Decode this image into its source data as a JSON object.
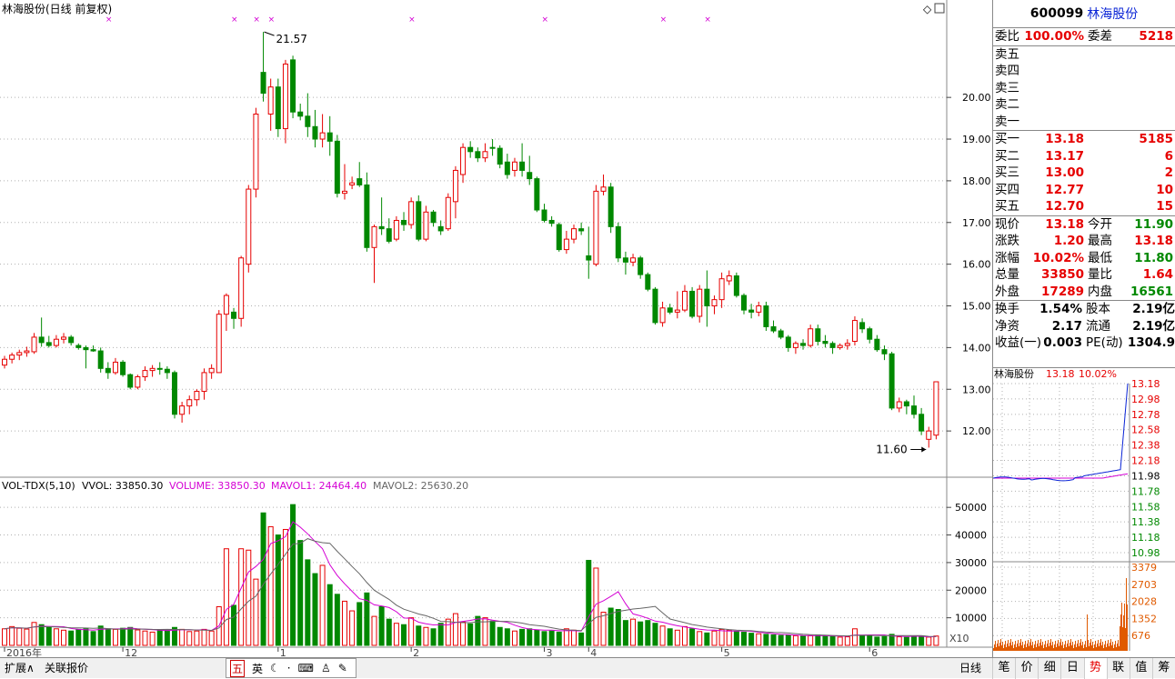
{
  "chart_title": "林海股份(日线 前复权)",
  "max_label": "21.57",
  "min_label": "11.60",
  "vol_header": {
    "name": "VOL-TDX(5,10)",
    "vvol": "VVOL: 33850.30",
    "volume": "VOLUME: 33850.30",
    "mavol1": "MAVOL1: 24464.40",
    "mavol2": "MAVOL2: 25630.20"
  },
  "x_tick_labels": [
    {
      "text": "2016年",
      "index": 0
    },
    {
      "text": "12",
      "index": 16
    },
    {
      "text": "1",
      "index": 37
    },
    {
      "text": "2",
      "index": 55
    },
    {
      "text": "3",
      "index": 73
    },
    {
      "text": "4",
      "index": 79
    },
    {
      "text": "5",
      "index": 97
    },
    {
      "text": "6",
      "index": 117
    }
  ],
  "price_axis_ticks": [
    "12.00",
    "13.00",
    "14.00",
    "15.00",
    "16.00",
    "17.00",
    "18.00",
    "19.00",
    "20.00"
  ],
  "vol_axis_ticks": [
    "10000",
    "20000",
    "30000",
    "40000",
    "50000"
  ],
  "vol_multiplier": "X10",
  "colors": {
    "up": "#e60000",
    "down": "#008800",
    "ma1": "#d400d4",
    "ma2": "#555555",
    "info_marker": "#d400d4"
  },
  "chart_data": {
    "type": "candlestick",
    "title": "林海股份(日线 前复权)",
    "ylim": [
      11.0,
      21.9
    ],
    "vol_ylim": [
      0,
      55000
    ],
    "info_marker_indices": [
      14,
      31,
      34,
      36,
      55,
      73,
      89,
      95
    ],
    "candles": [
      {
        "o": 13.58,
        "h": 13.8,
        "l": 13.5,
        "c": 13.72,
        "v": 6000
      },
      {
        "o": 13.72,
        "h": 13.88,
        "l": 13.62,
        "c": 13.82,
        "v": 6800
      },
      {
        "o": 13.82,
        "h": 13.95,
        "l": 13.7,
        "c": 13.88,
        "v": 6200
      },
      {
        "o": 13.88,
        "h": 14.02,
        "l": 13.78,
        "c": 13.92,
        "v": 5900
      },
      {
        "o": 13.9,
        "h": 14.35,
        "l": 13.85,
        "c": 14.25,
        "v": 8300
      },
      {
        "o": 14.25,
        "h": 14.72,
        "l": 14.02,
        "c": 14.12,
        "v": 7500
      },
      {
        "o": 14.12,
        "h": 14.28,
        "l": 14.0,
        "c": 14.05,
        "v": 6500
      },
      {
        "o": 14.05,
        "h": 14.3,
        "l": 14.0,
        "c": 14.2,
        "v": 6000
      },
      {
        "o": 14.2,
        "h": 14.35,
        "l": 14.1,
        "c": 14.25,
        "v": 5500
      },
      {
        "o": 14.25,
        "h": 14.3,
        "l": 14.05,
        "c": 14.12,
        "v": 5200
      },
      {
        "o": 14.05,
        "h": 14.1,
        "l": 13.95,
        "c": 14.0,
        "v": 5800
      },
      {
        "o": 14.0,
        "h": 14.05,
        "l": 13.5,
        "c": 13.95,
        "v": 6000
      },
      {
        "o": 13.95,
        "h": 14.05,
        "l": 13.9,
        "c": 13.92,
        "v": 5000
      },
      {
        "o": 13.92,
        "h": 14.0,
        "l": 13.4,
        "c": 13.5,
        "v": 7000
      },
      {
        "o": 13.5,
        "h": 13.65,
        "l": 13.25,
        "c": 13.4,
        "v": 6000
      },
      {
        "o": 13.4,
        "h": 13.75,
        "l": 13.35,
        "c": 13.65,
        "v": 5800
      },
      {
        "o": 13.65,
        "h": 13.7,
        "l": 13.3,
        "c": 13.35,
        "v": 6200
      },
      {
        "o": 13.35,
        "h": 13.38,
        "l": 13.0,
        "c": 13.05,
        "v": 6500
      },
      {
        "o": 13.05,
        "h": 13.35,
        "l": 13.0,
        "c": 13.3,
        "v": 5600
      },
      {
        "o": 13.3,
        "h": 13.55,
        "l": 13.2,
        "c": 13.45,
        "v": 5200
      },
      {
        "o": 13.45,
        "h": 13.58,
        "l": 13.3,
        "c": 13.5,
        "v": 4800
      },
      {
        "o": 13.5,
        "h": 13.65,
        "l": 13.35,
        "c": 13.48,
        "v": 5600
      },
      {
        "o": 13.48,
        "h": 13.55,
        "l": 13.25,
        "c": 13.4,
        "v": 5400
      },
      {
        "o": 13.4,
        "h": 13.45,
        "l": 12.3,
        "c": 12.4,
        "v": 6500
      },
      {
        "o": 12.4,
        "h": 12.7,
        "l": 12.2,
        "c": 12.6,
        "v": 5800
      },
      {
        "o": 12.6,
        "h": 12.85,
        "l": 12.4,
        "c": 12.75,
        "v": 5000
      },
      {
        "o": 12.75,
        "h": 13.0,
        "l": 12.6,
        "c": 12.95,
        "v": 5200
      },
      {
        "o": 12.95,
        "h": 13.5,
        "l": 12.75,
        "c": 13.4,
        "v": 5800
      },
      {
        "o": 13.4,
        "h": 13.6,
        "l": 13.25,
        "c": 13.5,
        "v": 5200
      },
      {
        "o": 13.4,
        "h": 14.9,
        "l": 13.4,
        "c": 14.8,
        "v": 14000
      },
      {
        "o": 14.8,
        "h": 15.3,
        "l": 14.4,
        "c": 15.25,
        "v": 35000
      },
      {
        "o": 14.85,
        "h": 14.95,
        "l": 14.45,
        "c": 14.7,
        "v": 14500
      },
      {
        "o": 14.7,
        "h": 16.2,
        "l": 14.5,
        "c": 16.15,
        "v": 35000
      },
      {
        "o": 16.0,
        "h": 17.9,
        "l": 15.8,
        "c": 17.8,
        "v": 34500
      },
      {
        "o": 17.8,
        "h": 19.75,
        "l": 17.6,
        "c": 19.6,
        "v": 24000
      },
      {
        "o": 20.6,
        "h": 21.57,
        "l": 19.9,
        "c": 20.1,
        "v": 48000
      },
      {
        "o": 19.6,
        "h": 20.45,
        "l": 19.2,
        "c": 20.25,
        "v": 43000
      },
      {
        "o": 20.25,
        "h": 20.45,
        "l": 19.05,
        "c": 19.25,
        "v": 40000
      },
      {
        "o": 19.25,
        "h": 20.9,
        "l": 18.9,
        "c": 20.8,
        "v": 42000
      },
      {
        "o": 20.9,
        "h": 21.0,
        "l": 19.5,
        "c": 19.65,
        "v": 51000
      },
      {
        "o": 19.65,
        "h": 19.85,
        "l": 19.45,
        "c": 19.55,
        "v": 38000
      },
      {
        "o": 19.55,
        "h": 20.1,
        "l": 19.05,
        "c": 19.3,
        "v": 31000
      },
      {
        "o": 19.3,
        "h": 19.7,
        "l": 18.8,
        "c": 19.0,
        "v": 26000
      },
      {
        "o": 19.0,
        "h": 19.6,
        "l": 18.8,
        "c": 19.15,
        "v": 29000
      },
      {
        "o": 19.15,
        "h": 19.55,
        "l": 18.6,
        "c": 18.95,
        "v": 22000
      },
      {
        "o": 18.95,
        "h": 19.1,
        "l": 17.6,
        "c": 17.7,
        "v": 18500
      },
      {
        "o": 17.7,
        "h": 18.4,
        "l": 17.55,
        "c": 17.75,
        "v": 16000
      },
      {
        "o": 17.9,
        "h": 18.1,
        "l": 17.8,
        "c": 17.95,
        "v": 12500
      },
      {
        "o": 18.05,
        "h": 18.45,
        "l": 17.85,
        "c": 17.9,
        "v": 15500
      },
      {
        "o": 17.9,
        "h": 18.2,
        "l": 16.3,
        "c": 16.4,
        "v": 19000
      },
      {
        "o": 16.4,
        "h": 16.95,
        "l": 15.55,
        "c": 16.9,
        "v": 10500
      },
      {
        "o": 16.9,
        "h": 17.6,
        "l": 16.7,
        "c": 16.85,
        "v": 14000
      },
      {
        "o": 16.85,
        "h": 17.1,
        "l": 16.5,
        "c": 16.55,
        "v": 9500
      },
      {
        "o": 16.6,
        "h": 17.15,
        "l": 16.55,
        "c": 17.05,
        "v": 8000
      },
      {
        "o": 17.05,
        "h": 17.25,
        "l": 16.8,
        "c": 16.95,
        "v": 7500
      },
      {
        "o": 16.95,
        "h": 17.6,
        "l": 16.85,
        "c": 17.5,
        "v": 10000
      },
      {
        "o": 17.5,
        "h": 17.65,
        "l": 16.55,
        "c": 16.6,
        "v": 7000
      },
      {
        "o": 16.6,
        "h": 17.4,
        "l": 16.55,
        "c": 17.25,
        "v": 6500
      },
      {
        "o": 17.25,
        "h": 17.3,
        "l": 16.9,
        "c": 17.0,
        "v": 6000
      },
      {
        "o": 16.9,
        "h": 17.05,
        "l": 16.7,
        "c": 16.8,
        "v": 8000
      },
      {
        "o": 16.85,
        "h": 17.7,
        "l": 16.8,
        "c": 17.6,
        "v": 9500
      },
      {
        "o": 17.5,
        "h": 18.35,
        "l": 17.1,
        "c": 18.25,
        "v": 11500
      },
      {
        "o": 18.15,
        "h": 18.9,
        "l": 17.95,
        "c": 18.8,
        "v": 8500
      },
      {
        "o": 18.8,
        "h": 18.95,
        "l": 18.55,
        "c": 18.7,
        "v": 7800
      },
      {
        "o": 18.7,
        "h": 18.8,
        "l": 18.45,
        "c": 18.55,
        "v": 10500
      },
      {
        "o": 18.55,
        "h": 18.9,
        "l": 18.45,
        "c": 18.7,
        "v": 10000
      },
      {
        "o": 18.8,
        "h": 19.0,
        "l": 18.6,
        "c": 18.78,
        "v": 8800
      },
      {
        "o": 18.78,
        "h": 18.85,
        "l": 18.3,
        "c": 18.4,
        "v": 6500
      },
      {
        "o": 18.45,
        "h": 18.65,
        "l": 18.05,
        "c": 18.15,
        "v": 6000
      },
      {
        "o": 18.25,
        "h": 18.55,
        "l": 18.1,
        "c": 18.45,
        "v": 5200
      },
      {
        "o": 18.45,
        "h": 18.9,
        "l": 18.1,
        "c": 18.25,
        "v": 5800
      },
      {
        "o": 18.2,
        "h": 18.6,
        "l": 17.9,
        "c": 18.05,
        "v": 6000
      },
      {
        "o": 18.05,
        "h": 18.1,
        "l": 17.25,
        "c": 17.3,
        "v": 5500
      },
      {
        "o": 17.3,
        "h": 17.45,
        "l": 17.0,
        "c": 17.05,
        "v": 5000
      },
      {
        "o": 17.05,
        "h": 17.15,
        "l": 16.9,
        "c": 16.98,
        "v": 5200
      },
      {
        "o": 16.95,
        "h": 17.0,
        "l": 16.3,
        "c": 16.35,
        "v": 4800
      },
      {
        "o": 16.35,
        "h": 16.8,
        "l": 16.25,
        "c": 16.6,
        "v": 6000
      },
      {
        "o": 16.6,
        "h": 16.95,
        "l": 16.5,
        "c": 16.85,
        "v": 5500
      },
      {
        "o": 16.85,
        "h": 17.0,
        "l": 16.7,
        "c": 16.8,
        "v": 4500
      },
      {
        "o": 16.2,
        "h": 16.9,
        "l": 15.65,
        "c": 16.1,
        "v": 30800
      },
      {
        "o": 16.0,
        "h": 17.9,
        "l": 15.95,
        "c": 17.75,
        "v": 28000
      },
      {
        "o": 17.75,
        "h": 18.15,
        "l": 17.65,
        "c": 17.85,
        "v": 12000
      },
      {
        "o": 17.85,
        "h": 17.95,
        "l": 16.75,
        "c": 16.9,
        "v": 13500
      },
      {
        "o": 16.9,
        "h": 17.0,
        "l": 16.05,
        "c": 16.15,
        "v": 13000
      },
      {
        "o": 16.15,
        "h": 16.3,
        "l": 15.75,
        "c": 16.05,
        "v": 9000
      },
      {
        "o": 16.05,
        "h": 16.25,
        "l": 15.95,
        "c": 16.15,
        "v": 9500
      },
      {
        "o": 16.15,
        "h": 16.2,
        "l": 15.65,
        "c": 15.75,
        "v": 8500
      },
      {
        "o": 15.75,
        "h": 15.8,
        "l": 15.35,
        "c": 15.4,
        "v": 9000
      },
      {
        "o": 15.4,
        "h": 15.45,
        "l": 14.55,
        "c": 14.6,
        "v": 8000
      },
      {
        "o": 14.6,
        "h": 15.1,
        "l": 14.5,
        "c": 14.95,
        "v": 7000
      },
      {
        "o": 14.95,
        "h": 15.05,
        "l": 14.8,
        "c": 14.85,
        "v": 6000
      },
      {
        "o": 14.85,
        "h": 15.35,
        "l": 14.7,
        "c": 14.9,
        "v": 5500
      },
      {
        "o": 14.9,
        "h": 15.5,
        "l": 14.85,
        "c": 15.35,
        "v": 6800
      },
      {
        "o": 15.35,
        "h": 15.45,
        "l": 14.7,
        "c": 14.75,
        "v": 6000
      },
      {
        "o": 14.75,
        "h": 15.5,
        "l": 14.6,
        "c": 15.4,
        "v": 5000
      },
      {
        "o": 15.4,
        "h": 15.85,
        "l": 14.5,
        "c": 15.0,
        "v": 4500
      },
      {
        "o": 15.0,
        "h": 15.25,
        "l": 14.8,
        "c": 15.15,
        "v": 5200
      },
      {
        "o": 15.15,
        "h": 15.8,
        "l": 14.95,
        "c": 15.65,
        "v": 5800
      },
      {
        "o": 15.6,
        "h": 15.85,
        "l": 15.5,
        "c": 15.72,
        "v": 5500
      },
      {
        "o": 15.72,
        "h": 15.8,
        "l": 15.2,
        "c": 15.25,
        "v": 5000
      },
      {
        "o": 15.25,
        "h": 15.3,
        "l": 14.8,
        "c": 14.9,
        "v": 4800
      },
      {
        "o": 14.9,
        "h": 15.05,
        "l": 14.7,
        "c": 14.85,
        "v": 4400
      },
      {
        "o": 14.85,
        "h": 15.1,
        "l": 14.75,
        "c": 15.0,
        "v": 4200
      },
      {
        "o": 15.0,
        "h": 15.1,
        "l": 14.4,
        "c": 14.5,
        "v": 4000
      },
      {
        "o": 14.5,
        "h": 14.65,
        "l": 14.35,
        "c": 14.4,
        "v": 3800
      },
      {
        "o": 14.4,
        "h": 14.45,
        "l": 14.2,
        "c": 14.25,
        "v": 3600
      },
      {
        "o": 14.25,
        "h": 14.3,
        "l": 13.9,
        "c": 14.0,
        "v": 3700
      },
      {
        "o": 14.0,
        "h": 14.15,
        "l": 13.85,
        "c": 14.1,
        "v": 3500
      },
      {
        "o": 14.1,
        "h": 14.2,
        "l": 13.95,
        "c": 14.05,
        "v": 3300
      },
      {
        "o": 14.05,
        "h": 14.55,
        "l": 14.0,
        "c": 14.45,
        "v": 3500
      },
      {
        "o": 14.45,
        "h": 14.55,
        "l": 14.05,
        "c": 14.15,
        "v": 3800
      },
      {
        "o": 14.15,
        "h": 14.3,
        "l": 14.0,
        "c": 14.1,
        "v": 3400
      },
      {
        "o": 14.1,
        "h": 14.15,
        "l": 13.85,
        "c": 14.0,
        "v": 3200
      },
      {
        "o": 14.0,
        "h": 14.1,
        "l": 13.95,
        "c": 14.05,
        "v": 3000
      },
      {
        "o": 14.05,
        "h": 14.2,
        "l": 13.95,
        "c": 14.1,
        "v": 3100
      },
      {
        "o": 14.15,
        "h": 14.75,
        "l": 14.05,
        "c": 14.65,
        "v": 6000
      },
      {
        "o": 14.6,
        "h": 14.7,
        "l": 14.35,
        "c": 14.45,
        "v": 3500
      },
      {
        "o": 14.45,
        "h": 14.5,
        "l": 14.1,
        "c": 14.2,
        "v": 3300
      },
      {
        "o": 14.2,
        "h": 14.3,
        "l": 13.9,
        "c": 13.95,
        "v": 3000
      },
      {
        "o": 13.95,
        "h": 14.05,
        "l": 13.7,
        "c": 13.85,
        "v": 3200
      },
      {
        "o": 13.85,
        "h": 13.9,
        "l": 12.5,
        "c": 12.55,
        "v": 4000
      },
      {
        "o": 12.55,
        "h": 12.8,
        "l": 12.45,
        "c": 12.7,
        "v": 3100
      },
      {
        "o": 12.7,
        "h": 12.75,
        "l": 12.4,
        "c": 12.6,
        "v": 2900
      },
      {
        "o": 12.6,
        "h": 12.85,
        "l": 12.3,
        "c": 12.4,
        "v": 3200
      },
      {
        "o": 12.4,
        "h": 12.55,
        "l": 11.9,
        "c": 12.0,
        "v": 3300
      },
      {
        "o": 11.8,
        "h": 12.1,
        "l": 11.6,
        "c": 12.0,
        "v": 3000
      },
      {
        "o": 11.9,
        "h": 13.18,
        "l": 11.8,
        "c": 13.18,
        "v": 3385
      }
    ]
  },
  "quote": {
    "code": "600099",
    "name": "林海股份",
    "wb_label": "委比",
    "wb_value": "100.00%",
    "wc_label": "委差",
    "wc_value": "5218",
    "sell_labels": [
      "卖五",
      "卖四",
      "卖三",
      "卖二",
      "卖一"
    ],
    "buys": [
      {
        "label": "买一",
        "price": "13.18",
        "vol": "5185"
      },
      {
        "label": "买二",
        "price": "13.17",
        "vol": "6"
      },
      {
        "label": "买三",
        "price": "13.00",
        "vol": "2"
      },
      {
        "label": "买四",
        "price": "12.77",
        "vol": "10"
      },
      {
        "label": "买五",
        "price": "12.70",
        "vol": "15"
      }
    ],
    "stats": [
      {
        "l1": "现价",
        "v1": "13.18",
        "c1": "red",
        "l2": "今开",
        "v2": "11.90",
        "c2": "green"
      },
      {
        "l1": "涨跌",
        "v1": "1.20",
        "c1": "red",
        "l2": "最高",
        "v2": "13.18",
        "c2": "red"
      },
      {
        "l1": "涨幅",
        "v1": "10.02%",
        "c1": "red",
        "l2": "最低",
        "v2": "11.80",
        "c2": "green"
      },
      {
        "l1": "总量",
        "v1": "33850",
        "c1": "red",
        "l2": "量比",
        "v2": "1.64",
        "c2": "red"
      },
      {
        "l1": "外盘",
        "v1": "17289",
        "c1": "red",
        "l2": "内盘",
        "v2": "16561",
        "c2": "green"
      }
    ],
    "fund": [
      {
        "l1": "换手",
        "v1": "1.54%",
        "l2": "股本",
        "v2": "2.19亿"
      },
      {
        "l1": "净资",
        "v1": "2.17",
        "l2": "流通",
        "v2": "2.19亿"
      },
      {
        "l1": "收益(一)",
        "v1": "0.003",
        "l2": "PE(动)",
        "v2": "1304.9"
      }
    ],
    "mini_title": "林海股份",
    "mini_price": "13.18",
    "mini_pct": "10.02%",
    "mini_price_ticks": [
      "13.18",
      "12.98",
      "12.78",
      "12.58",
      "12.38",
      "12.18",
      "11.98",
      "11.78",
      "11.58",
      "11.38",
      "11.18",
      "10.98"
    ],
    "mini_vol_ticks": [
      "3379",
      "2703",
      "2028",
      "1352",
      "676"
    ]
  },
  "bottom": {
    "expand": "扩展∧",
    "related": "关联报价",
    "period": "日线",
    "ime": [
      "五",
      "英"
    ],
    "tabs": [
      "笔",
      "价",
      "细",
      "日",
      "势",
      "联",
      "值",
      "筹"
    ]
  }
}
